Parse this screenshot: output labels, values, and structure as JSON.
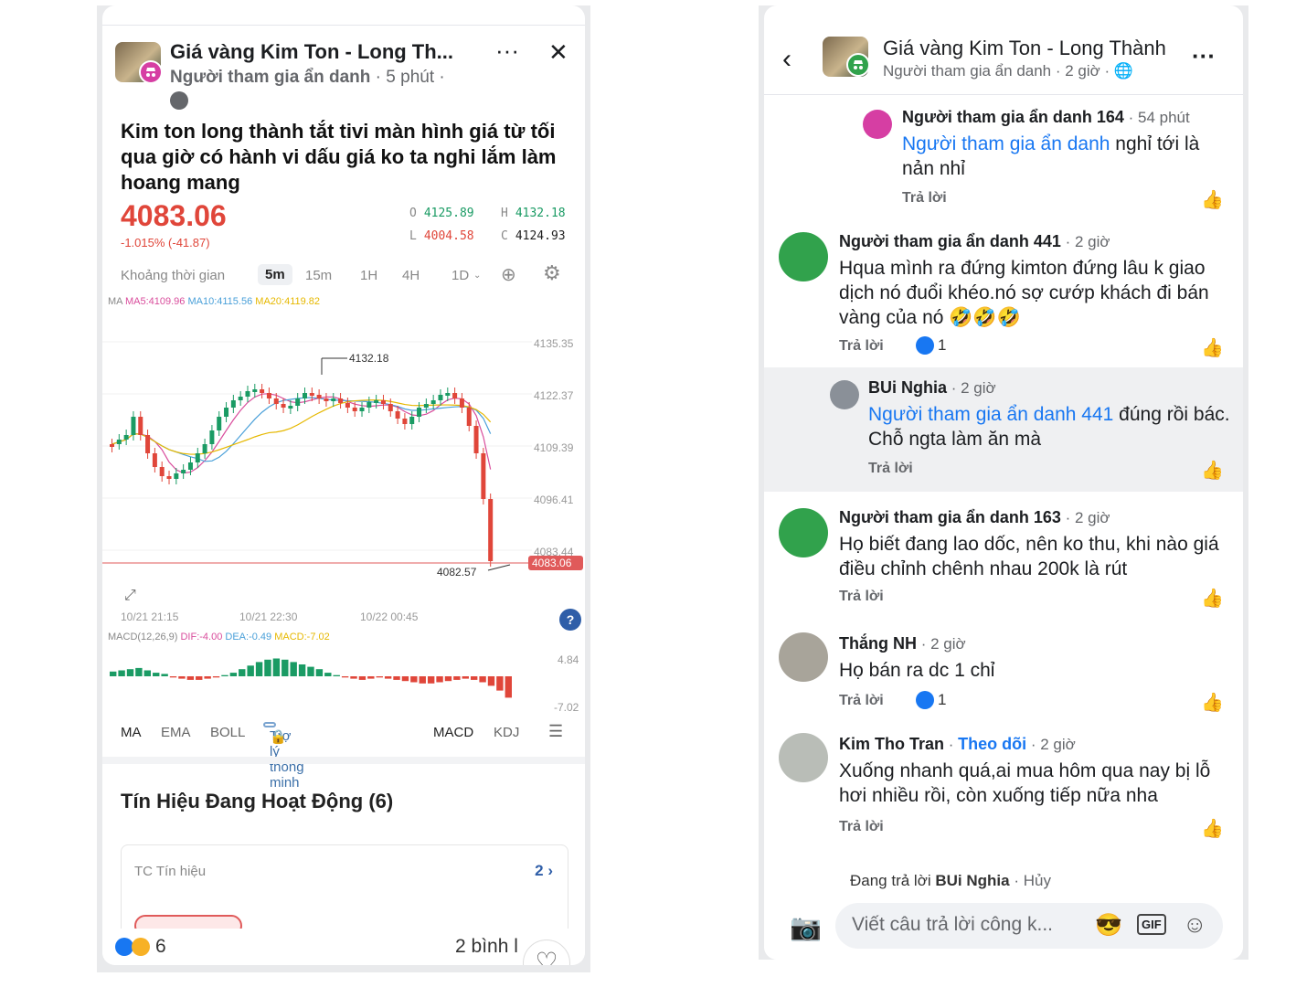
{
  "left": {
    "group_title": "Giá vàng Kim Ton - Long Th...",
    "author": "Người tham gia ẩn danh",
    "post_time": "5 phút",
    "post_text": "Kim ton long thành tắt tivi màn hình giá từ tối qua giờ có hành vi dấu giá ko ta nghi lắm làm hoang mang",
    "price": "4083.06",
    "change": "-1.015% (-41.87)",
    "ohlc": {
      "o_label": "O",
      "o": "4125.89",
      "h_label": "H",
      "h": "4132.18",
      "l_label": "L",
      "l": "4004.58",
      "c_label": "C",
      "c": "4124.93"
    },
    "timeframes": [
      "Khoảng thời gian",
      "5m",
      "15m",
      "1H",
      "4H",
      "1D"
    ],
    "ma_prefix": "MA",
    "ma5": "MA5:4109.96",
    "ma10": "MA10:4115.56",
    "ma20": "MA20:4119.82",
    "chart_data": {
      "type": "candlestick",
      "y_ticks": [
        "4135.35",
        "4122.37",
        "4109.39",
        "4096.41",
        "4083.44"
      ],
      "x_ticks": [
        "10/21 21:15",
        "10/21 22:30",
        "10/22 00:45"
      ],
      "high_label": "4132.18",
      "low_label": "4082.57",
      "last_label": "4083.06",
      "ylim": [
        4080,
        4140
      ]
    },
    "macd_prefix": "MACD(12,26,9)",
    "macd_dif": "DIF:-4.00",
    "macd_dea": "DEA:-0.49",
    "macd_val": "MACD:-7.02",
    "macd_ticks": [
      "4.84",
      "-7.02"
    ],
    "indicator_tabs": [
      "MA",
      "EMA",
      "BOLL",
      "Trợ lý thông minh",
      "MACD",
      "KDJ"
    ],
    "signals_title": "Tín Hiệu Đang Hoạt Động (6)",
    "signal_card_label": "TC Tín hiệu",
    "signal_count": "2",
    "reaction_count": "6",
    "comment_count": "2 bình l"
  },
  "right": {
    "group_title": "Giá vàng Kim Ton - Long Thành",
    "meta": "Người tham gia ẩn danh · 2 giờ ·",
    "reply_label": "Trả lời",
    "comments": [
      {
        "name": "Người tham gia ẩn danh 164",
        "time": "54 phút",
        "mention": "Người tham gia ẩn danh",
        "text_after_mention": " nghỉ tới là nản nhỉ"
      },
      {
        "name": "Người tham gia ẩn danh 441",
        "time": "2 giờ",
        "text": "Hqua mình ra đứng kimton đứng lâu k giao dịch nó đuổi khéo.nó sợ cướp khách đi bán vàng của nó 🤣🤣🤣",
        "likes": "1"
      },
      {
        "name": "BUi Nghia",
        "time": "2 giờ",
        "mention": "Người tham gia ẩn danh 441",
        "text_after_mention": " đúng rồi bác. Chỗ ngta làm ăn mà"
      },
      {
        "name": "Người tham gia ẩn danh 163",
        "time": "2 giờ",
        "text": "Họ biết đang lao dốc, nên ko thu, khi nào giá điều chỉnh chênh nhau 200k là rút"
      },
      {
        "name": "Thắng NH",
        "time": "2 giờ",
        "text": "Họ bán ra dc 1 chỉ",
        "likes": "1"
      },
      {
        "name": "Kim Tho Tran",
        "follow": "Theo dõi",
        "time": "2 giờ",
        "text": "Xuống nhanh quá,ai mua hôm qua nay bị lỗ hơi nhiều rồi, còn xuống tiếp nữa nha"
      }
    ],
    "replying_prefix": "Đang trả lời",
    "replying_to": "BUi Nghia",
    "cancel": "Hủy",
    "input_placeholder": "Viết câu trả lời công k...",
    "gif": "GIF"
  }
}
